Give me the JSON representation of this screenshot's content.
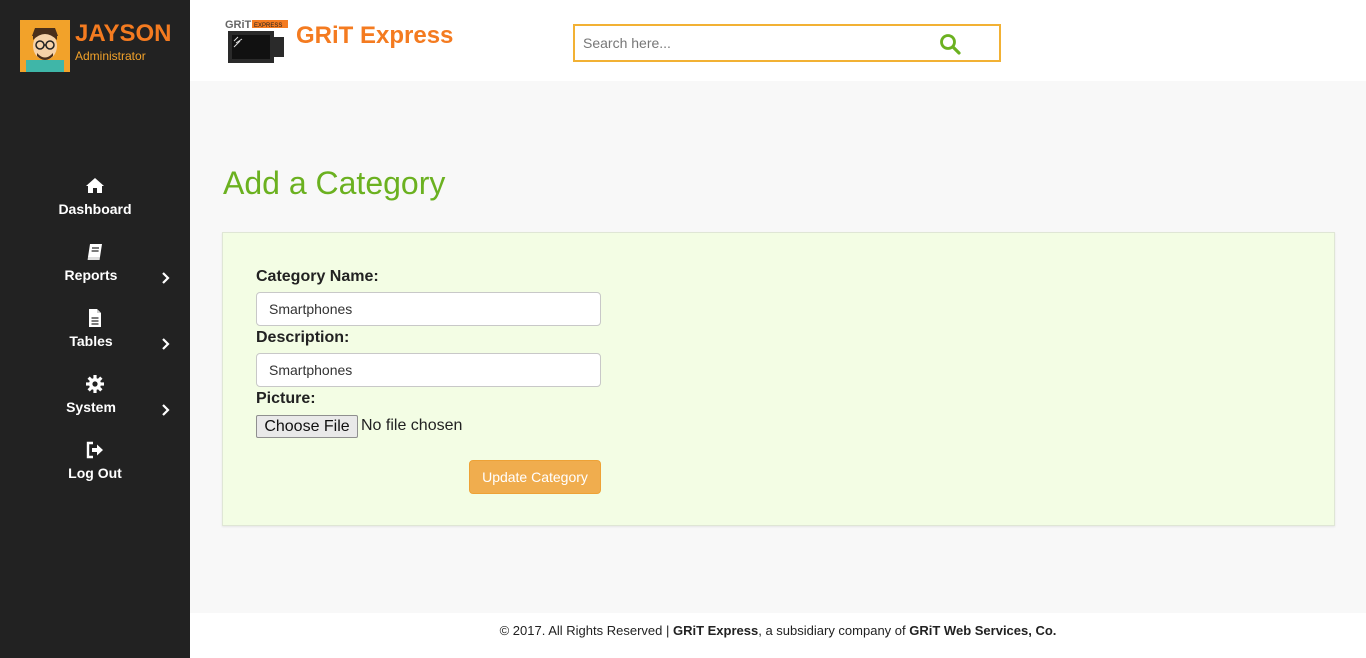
{
  "user": {
    "name": "JAYSON",
    "role": "Administrator"
  },
  "brand": {
    "name": "GRiT Express",
    "logo_text": "GRiT EXPRESS"
  },
  "search": {
    "placeholder": "Search here..."
  },
  "nav": [
    {
      "label": "Dashboard",
      "icon": "home-icon",
      "has_submenu": false
    },
    {
      "label": "Reports",
      "icon": "book-icon",
      "has_submenu": true
    },
    {
      "label": "Tables",
      "icon": "file-icon",
      "has_submenu": true
    },
    {
      "label": "System",
      "icon": "gear-icon",
      "has_submenu": true
    },
    {
      "label": "Log Out",
      "icon": "sign-out-icon",
      "has_submenu": false
    }
  ],
  "page": {
    "title": "Add a Category"
  },
  "form": {
    "category_name_label": "Category Name:",
    "category_name_value": "Smartphones",
    "description_label": "Description:",
    "description_value": "Smartphones",
    "picture_label": "Picture:",
    "file_button_label": "Choose File",
    "file_status": "No file chosen",
    "submit_label": "Update Category"
  },
  "footer": {
    "prefix": "© 2017. All Rights Reserved | ",
    "brand": "GRiT Express",
    "middle": ", a subsidiary company of ",
    "company": "GRiT Web Services, Co."
  },
  "colors": {
    "sidebar_bg": "#222222",
    "accent_orange": "#f47b20",
    "accent_green": "#6bb120",
    "panel_bg": "#f3fde4",
    "button_orange": "#f0ad4e"
  }
}
